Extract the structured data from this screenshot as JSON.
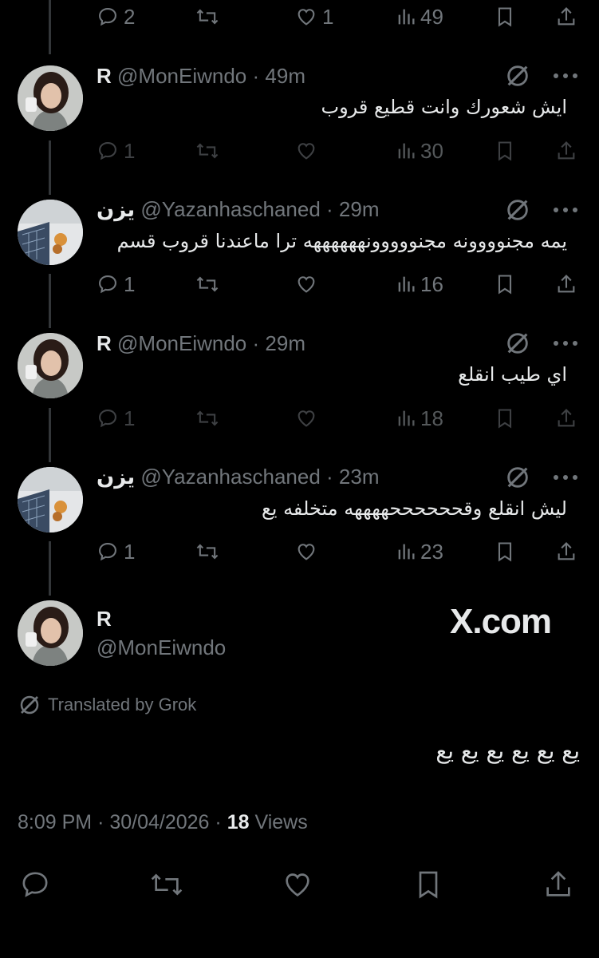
{
  "top_actions": {
    "replies": "2",
    "reposts": "",
    "likes": "1",
    "views": "49"
  },
  "replies": [
    {
      "name": "R",
      "handle": "@MonEiwndo",
      "time": "49m",
      "text": "ايش شعورك وانت قطيع قروب",
      "replies": "1",
      "likes": "",
      "views": "30",
      "avatar": "girl"
    },
    {
      "name": "يزن",
      "handle": "@Yazanhaschaned",
      "time": "29m",
      "text": "يمه مجنوووونه مجنووووونههههههه ترا ماعندنا قروب قسم",
      "replies": "1",
      "likes": "",
      "views": "16",
      "avatar": "room"
    },
    {
      "name": "R",
      "handle": "@MonEiwndo",
      "time": "29m",
      "text": "اي طيب انقلع",
      "replies": "1",
      "likes": "",
      "views": "18",
      "avatar": "girl"
    },
    {
      "name": "يزن",
      "handle": "@Yazanhaschaned",
      "time": "23m",
      "text": "ليش انقلع وقححححححههههه متخلفه يع",
      "replies": "1",
      "likes": "",
      "views": "23",
      "avatar": "room"
    }
  ],
  "main_post": {
    "name": "R",
    "handle": "@MonEiwndo",
    "watermark": "X.com",
    "translated_label": "Translated by Grok",
    "text": "يع يع يع يع يع يع",
    "time": "8:09 PM",
    "date": "30/04/2026",
    "views_count": "18",
    "views_label": "Views"
  },
  "colors": {
    "background": "#000000",
    "text": "#e7e9ea",
    "muted": "#71767b",
    "line": "#333639"
  }
}
